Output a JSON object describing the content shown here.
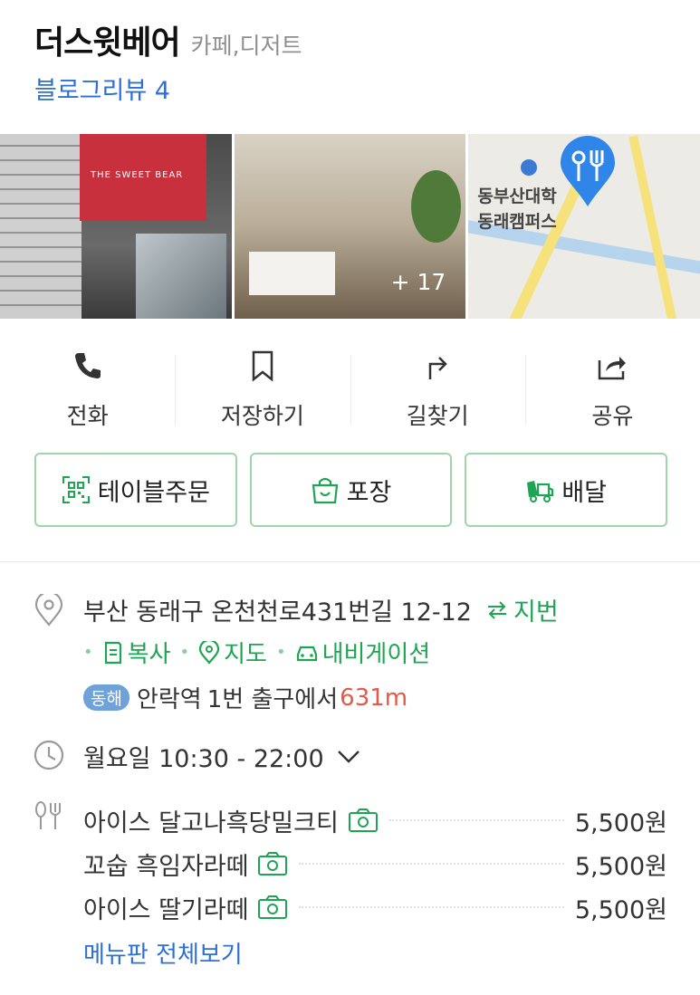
{
  "place": {
    "name": "더스윗베어",
    "category": "카페,디저트",
    "blog_review": "블로그리뷰 4"
  },
  "photos": {
    "sign_text": "THE SWEET BEAR",
    "more_count": "+ 17",
    "map_labels": [
      "동부산대학",
      "동래캠퍼스"
    ]
  },
  "actions": [
    {
      "label": "전화",
      "icon": "phone-icon"
    },
    {
      "label": "저장하기",
      "icon": "bookmark-icon"
    },
    {
      "label": "길찾기",
      "icon": "directions-icon"
    },
    {
      "label": "공유",
      "icon": "share-icon"
    }
  ],
  "order_buttons": [
    {
      "label": "테이블주문",
      "icon": "qr-code-icon"
    },
    {
      "label": "포장",
      "icon": "shopping-bag-icon"
    },
    {
      "label": "배달",
      "icon": "delivery-truck-icon"
    }
  ],
  "info": {
    "address": "부산 동래구 온천천로431번길 12-12",
    "jibun_label": "지번",
    "copy_label": "복사",
    "map_label": "지도",
    "navigation_label": "내비게이션",
    "line_badge": "동해",
    "station_name": "안락역",
    "station_exit": "1번 출구에서",
    "distance": "631m",
    "hours": "월요일 10:30 - 22:00"
  },
  "menu": {
    "items": [
      {
        "name": "아이스 달고나흑당밀크티",
        "price": "5,500원"
      },
      {
        "name": "꼬숩 흑임자라떼",
        "price": "5,500원"
      },
      {
        "name": "아이스 딸기라떼",
        "price": "5,500원"
      }
    ],
    "full_menu_label": "메뉴판 전체보기"
  },
  "colors": {
    "accent_green": "#1ea554",
    "link_blue": "#2d6fd6",
    "distance_red": "#e25a4a",
    "line_badge": "#6fa2d8"
  }
}
